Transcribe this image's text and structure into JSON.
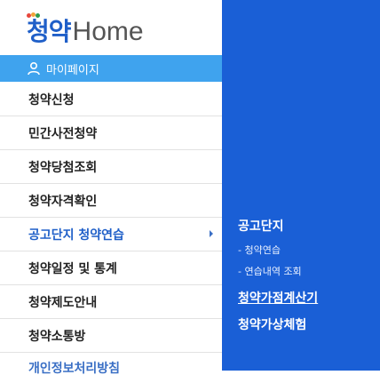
{
  "logo": {
    "korean": "청약",
    "english": "Home"
  },
  "mypage": {
    "label": "마이페이지",
    "icon": "user-icon"
  },
  "menu": {
    "items": [
      {
        "label": "청약신청"
      },
      {
        "label": "민간사전청약"
      },
      {
        "label": "청약당첨조회"
      },
      {
        "label": "청약자격확인"
      },
      {
        "label": "공고단지 청약연습"
      },
      {
        "label": "청약일정 및 통계"
      },
      {
        "label": "청약제도안내"
      },
      {
        "label": "청약소통방"
      },
      {
        "label": "개인정보처리방침"
      }
    ]
  },
  "submenu": {
    "title": "공고단지",
    "items": [
      {
        "label": "- 청약연습"
      },
      {
        "label": "- 연습내역 조회"
      }
    ],
    "links": [
      {
        "label": "청약가점계산기"
      },
      {
        "label": "청약가상체험"
      }
    ]
  },
  "colors": {
    "accent": "#1f5fc8",
    "mypage_bg": "#3fa3ee",
    "panel_bg": "#1a5fd6"
  }
}
